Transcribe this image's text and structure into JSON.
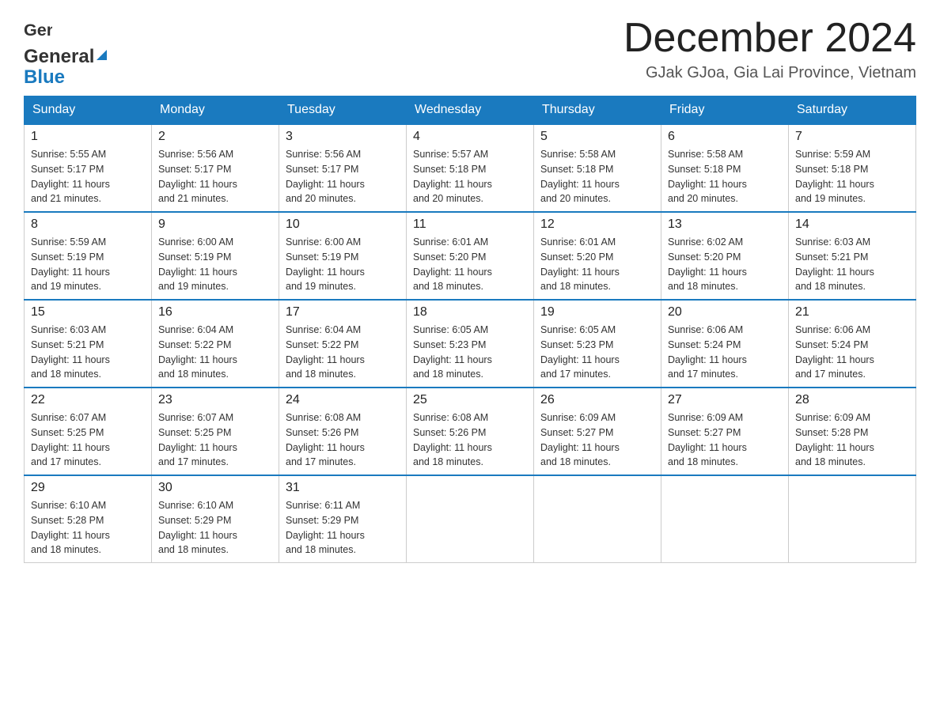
{
  "header": {
    "month_title": "December 2024",
    "location": "GJak GJoa, Gia Lai Province, Vietnam",
    "logo_general": "General",
    "logo_blue": "Blue"
  },
  "days_of_week": [
    "Sunday",
    "Monday",
    "Tuesday",
    "Wednesday",
    "Thursday",
    "Friday",
    "Saturday"
  ],
  "weeks": [
    [
      {
        "day": "1",
        "sunrise": "5:55 AM",
        "sunset": "5:17 PM",
        "daylight": "11 hours and 21 minutes."
      },
      {
        "day": "2",
        "sunrise": "5:56 AM",
        "sunset": "5:17 PM",
        "daylight": "11 hours and 21 minutes."
      },
      {
        "day": "3",
        "sunrise": "5:56 AM",
        "sunset": "5:17 PM",
        "daylight": "11 hours and 20 minutes."
      },
      {
        "day": "4",
        "sunrise": "5:57 AM",
        "sunset": "5:18 PM",
        "daylight": "11 hours and 20 minutes."
      },
      {
        "day": "5",
        "sunrise": "5:58 AM",
        "sunset": "5:18 PM",
        "daylight": "11 hours and 20 minutes."
      },
      {
        "day": "6",
        "sunrise": "5:58 AM",
        "sunset": "5:18 PM",
        "daylight": "11 hours and 20 minutes."
      },
      {
        "day": "7",
        "sunrise": "5:59 AM",
        "sunset": "5:18 PM",
        "daylight": "11 hours and 19 minutes."
      }
    ],
    [
      {
        "day": "8",
        "sunrise": "5:59 AM",
        "sunset": "5:19 PM",
        "daylight": "11 hours and 19 minutes."
      },
      {
        "day": "9",
        "sunrise": "6:00 AM",
        "sunset": "5:19 PM",
        "daylight": "11 hours and 19 minutes."
      },
      {
        "day": "10",
        "sunrise": "6:00 AM",
        "sunset": "5:19 PM",
        "daylight": "11 hours and 19 minutes."
      },
      {
        "day": "11",
        "sunrise": "6:01 AM",
        "sunset": "5:20 PM",
        "daylight": "11 hours and 18 minutes."
      },
      {
        "day": "12",
        "sunrise": "6:01 AM",
        "sunset": "5:20 PM",
        "daylight": "11 hours and 18 minutes."
      },
      {
        "day": "13",
        "sunrise": "6:02 AM",
        "sunset": "5:20 PM",
        "daylight": "11 hours and 18 minutes."
      },
      {
        "day": "14",
        "sunrise": "6:03 AM",
        "sunset": "5:21 PM",
        "daylight": "11 hours and 18 minutes."
      }
    ],
    [
      {
        "day": "15",
        "sunrise": "6:03 AM",
        "sunset": "5:21 PM",
        "daylight": "11 hours and 18 minutes."
      },
      {
        "day": "16",
        "sunrise": "6:04 AM",
        "sunset": "5:22 PM",
        "daylight": "11 hours and 18 minutes."
      },
      {
        "day": "17",
        "sunrise": "6:04 AM",
        "sunset": "5:22 PM",
        "daylight": "11 hours and 18 minutes."
      },
      {
        "day": "18",
        "sunrise": "6:05 AM",
        "sunset": "5:23 PM",
        "daylight": "11 hours and 18 minutes."
      },
      {
        "day": "19",
        "sunrise": "6:05 AM",
        "sunset": "5:23 PM",
        "daylight": "11 hours and 17 minutes."
      },
      {
        "day": "20",
        "sunrise": "6:06 AM",
        "sunset": "5:24 PM",
        "daylight": "11 hours and 17 minutes."
      },
      {
        "day": "21",
        "sunrise": "6:06 AM",
        "sunset": "5:24 PM",
        "daylight": "11 hours and 17 minutes."
      }
    ],
    [
      {
        "day": "22",
        "sunrise": "6:07 AM",
        "sunset": "5:25 PM",
        "daylight": "11 hours and 17 minutes."
      },
      {
        "day": "23",
        "sunrise": "6:07 AM",
        "sunset": "5:25 PM",
        "daylight": "11 hours and 17 minutes."
      },
      {
        "day": "24",
        "sunrise": "6:08 AM",
        "sunset": "5:26 PM",
        "daylight": "11 hours and 17 minutes."
      },
      {
        "day": "25",
        "sunrise": "6:08 AM",
        "sunset": "5:26 PM",
        "daylight": "11 hours and 18 minutes."
      },
      {
        "day": "26",
        "sunrise": "6:09 AM",
        "sunset": "5:27 PM",
        "daylight": "11 hours and 18 minutes."
      },
      {
        "day": "27",
        "sunrise": "6:09 AM",
        "sunset": "5:27 PM",
        "daylight": "11 hours and 18 minutes."
      },
      {
        "day": "28",
        "sunrise": "6:09 AM",
        "sunset": "5:28 PM",
        "daylight": "11 hours and 18 minutes."
      }
    ],
    [
      {
        "day": "29",
        "sunrise": "6:10 AM",
        "sunset": "5:28 PM",
        "daylight": "11 hours and 18 minutes."
      },
      {
        "day": "30",
        "sunrise": "6:10 AM",
        "sunset": "5:29 PM",
        "daylight": "11 hours and 18 minutes."
      },
      {
        "day": "31",
        "sunrise": "6:11 AM",
        "sunset": "5:29 PM",
        "daylight": "11 hours and 18 minutes."
      },
      null,
      null,
      null,
      null
    ]
  ]
}
